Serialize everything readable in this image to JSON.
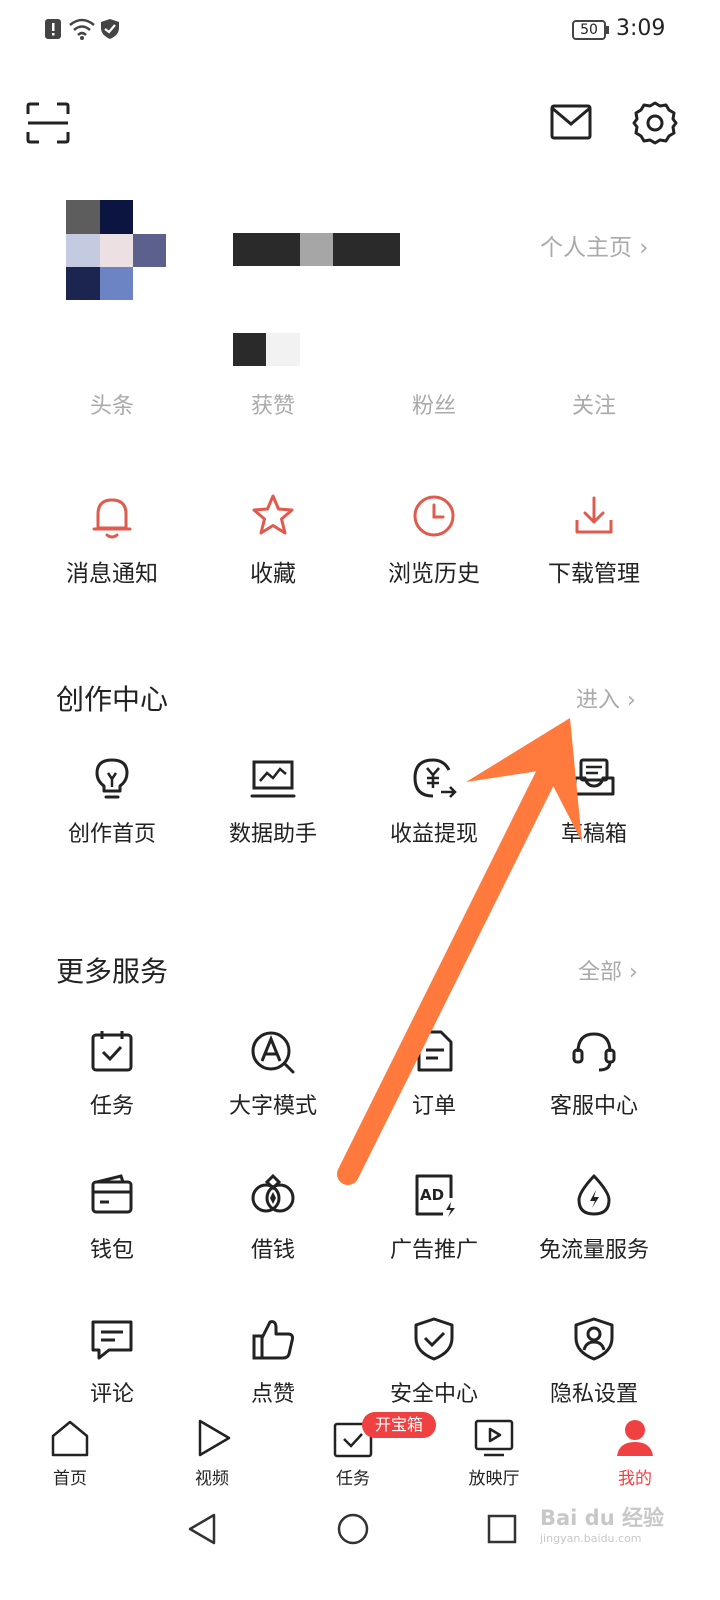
{
  "status_bar": {
    "battery": "50",
    "time": "3:09"
  },
  "header": {
    "profile_link": "个人主页 ›"
  },
  "stats": {
    "items": [
      {
        "label": "头条"
      },
      {
        "label": "获赞"
      },
      {
        "label": "粉丝"
      },
      {
        "label": "关注"
      }
    ]
  },
  "quick": {
    "items": [
      {
        "label": "消息通知",
        "icon": "bell-icon"
      },
      {
        "label": "收藏",
        "icon": "star-icon"
      },
      {
        "label": "浏览历史",
        "icon": "clock-icon"
      },
      {
        "label": "下载管理",
        "icon": "download-icon"
      }
    ]
  },
  "creation": {
    "title": "创作中心",
    "link": "进入 ›",
    "items": [
      {
        "label": "创作首页",
        "icon": "lightbulb-icon"
      },
      {
        "label": "数据助手",
        "icon": "chart-monitor-icon"
      },
      {
        "label": "收益提现",
        "icon": "yen-withdraw-icon"
      },
      {
        "label": "草稿箱",
        "icon": "draft-box-icon"
      }
    ]
  },
  "more": {
    "title": "更多服务",
    "link": "全部 ›",
    "rows": [
      [
        {
          "label": "任务",
          "icon": "task-icon"
        },
        {
          "label": "大字模式",
          "icon": "large-font-icon"
        },
        {
          "label": "订单",
          "icon": "order-icon"
        },
        {
          "label": "客服中心",
          "icon": "headset-icon"
        }
      ],
      [
        {
          "label": "钱包",
          "icon": "wallet-icon"
        },
        {
          "label": "借钱",
          "icon": "loan-icon"
        },
        {
          "label": "广告推广",
          "icon": "ad-icon"
        },
        {
          "label": "免流量服务",
          "icon": "data-free-icon"
        }
      ],
      [
        {
          "label": "评论",
          "icon": "comment-icon"
        },
        {
          "label": "点赞",
          "icon": "thumbs-up-icon"
        },
        {
          "label": "安全中心",
          "icon": "shield-icon"
        },
        {
          "label": "隐私设置",
          "icon": "privacy-icon"
        }
      ]
    ]
  },
  "tabbar": {
    "items": [
      {
        "label": "首页",
        "icon": "home-icon"
      },
      {
        "label": "视频",
        "icon": "video-icon"
      },
      {
        "label": "任务",
        "icon": "task-tab-icon",
        "badge": "开宝箱"
      },
      {
        "label": "放映厅",
        "icon": "cinema-icon"
      },
      {
        "label": "我的",
        "icon": "profile-icon"
      }
    ]
  },
  "watermark": {
    "text": "Bai du 经验",
    "subtext": "jingyan.baidu.com"
  },
  "colors": {
    "accent": "#f04142",
    "icon_red": "#e05a4d",
    "arrow": "#ff7a3c",
    "badge": "#f04142",
    "gray_text": "#aaaaaa"
  }
}
